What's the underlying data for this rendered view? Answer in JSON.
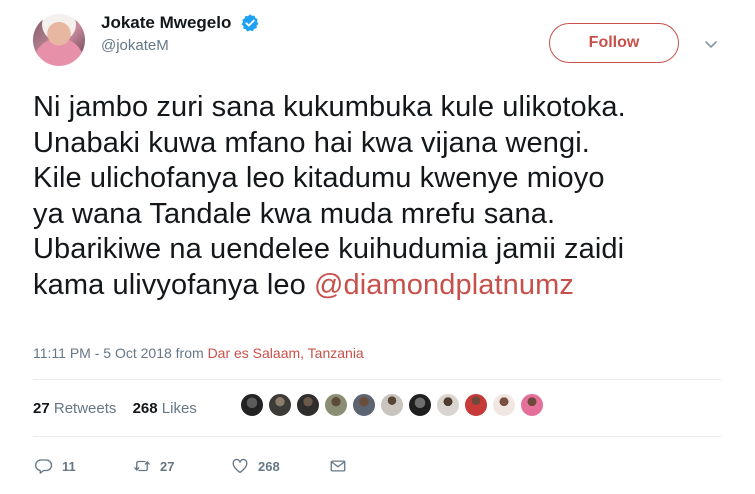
{
  "author": {
    "display_name": "Jokate Mwegelo",
    "handle": "@jokateM",
    "verified": true
  },
  "follow_label": "Follow",
  "tweet": {
    "lines": [
      "Ni jambo zuri sana kukumbuka kule ulikotoka.",
      "Unabaki kuwa mfano hai kwa vijana wengi.",
      "Kile ulichofanya leo kitadumu kwenye mioyo",
      "ya wana Tandale kwa muda mrefu sana.",
      "Ubarikiwe na uendelee kuihudumia jamii zaidi",
      "kama ulivyofanya leo "
    ],
    "mention": "@diamondplatnumz"
  },
  "meta": {
    "timestamp": "11:11 PM - 5 Oct 2018",
    "from_word": "from",
    "place": "Dar es Salaam, Tanzania"
  },
  "stats": {
    "retweets_count": "27",
    "retweets_label": "Retweets",
    "likes_count": "268",
    "likes_label": "Likes"
  },
  "actions": {
    "reply_count": "11",
    "retweet_count": "27",
    "like_count": "268"
  },
  "colors": {
    "accent": "#c8504a",
    "verified_blue": "#1da1f2",
    "muted": "#657786"
  },
  "icons": {
    "verified": "verified-badge-icon",
    "caret": "chevron-down-icon",
    "reply": "reply-icon",
    "retweet": "retweet-icon",
    "like": "heart-icon",
    "dm": "envelope-icon"
  }
}
